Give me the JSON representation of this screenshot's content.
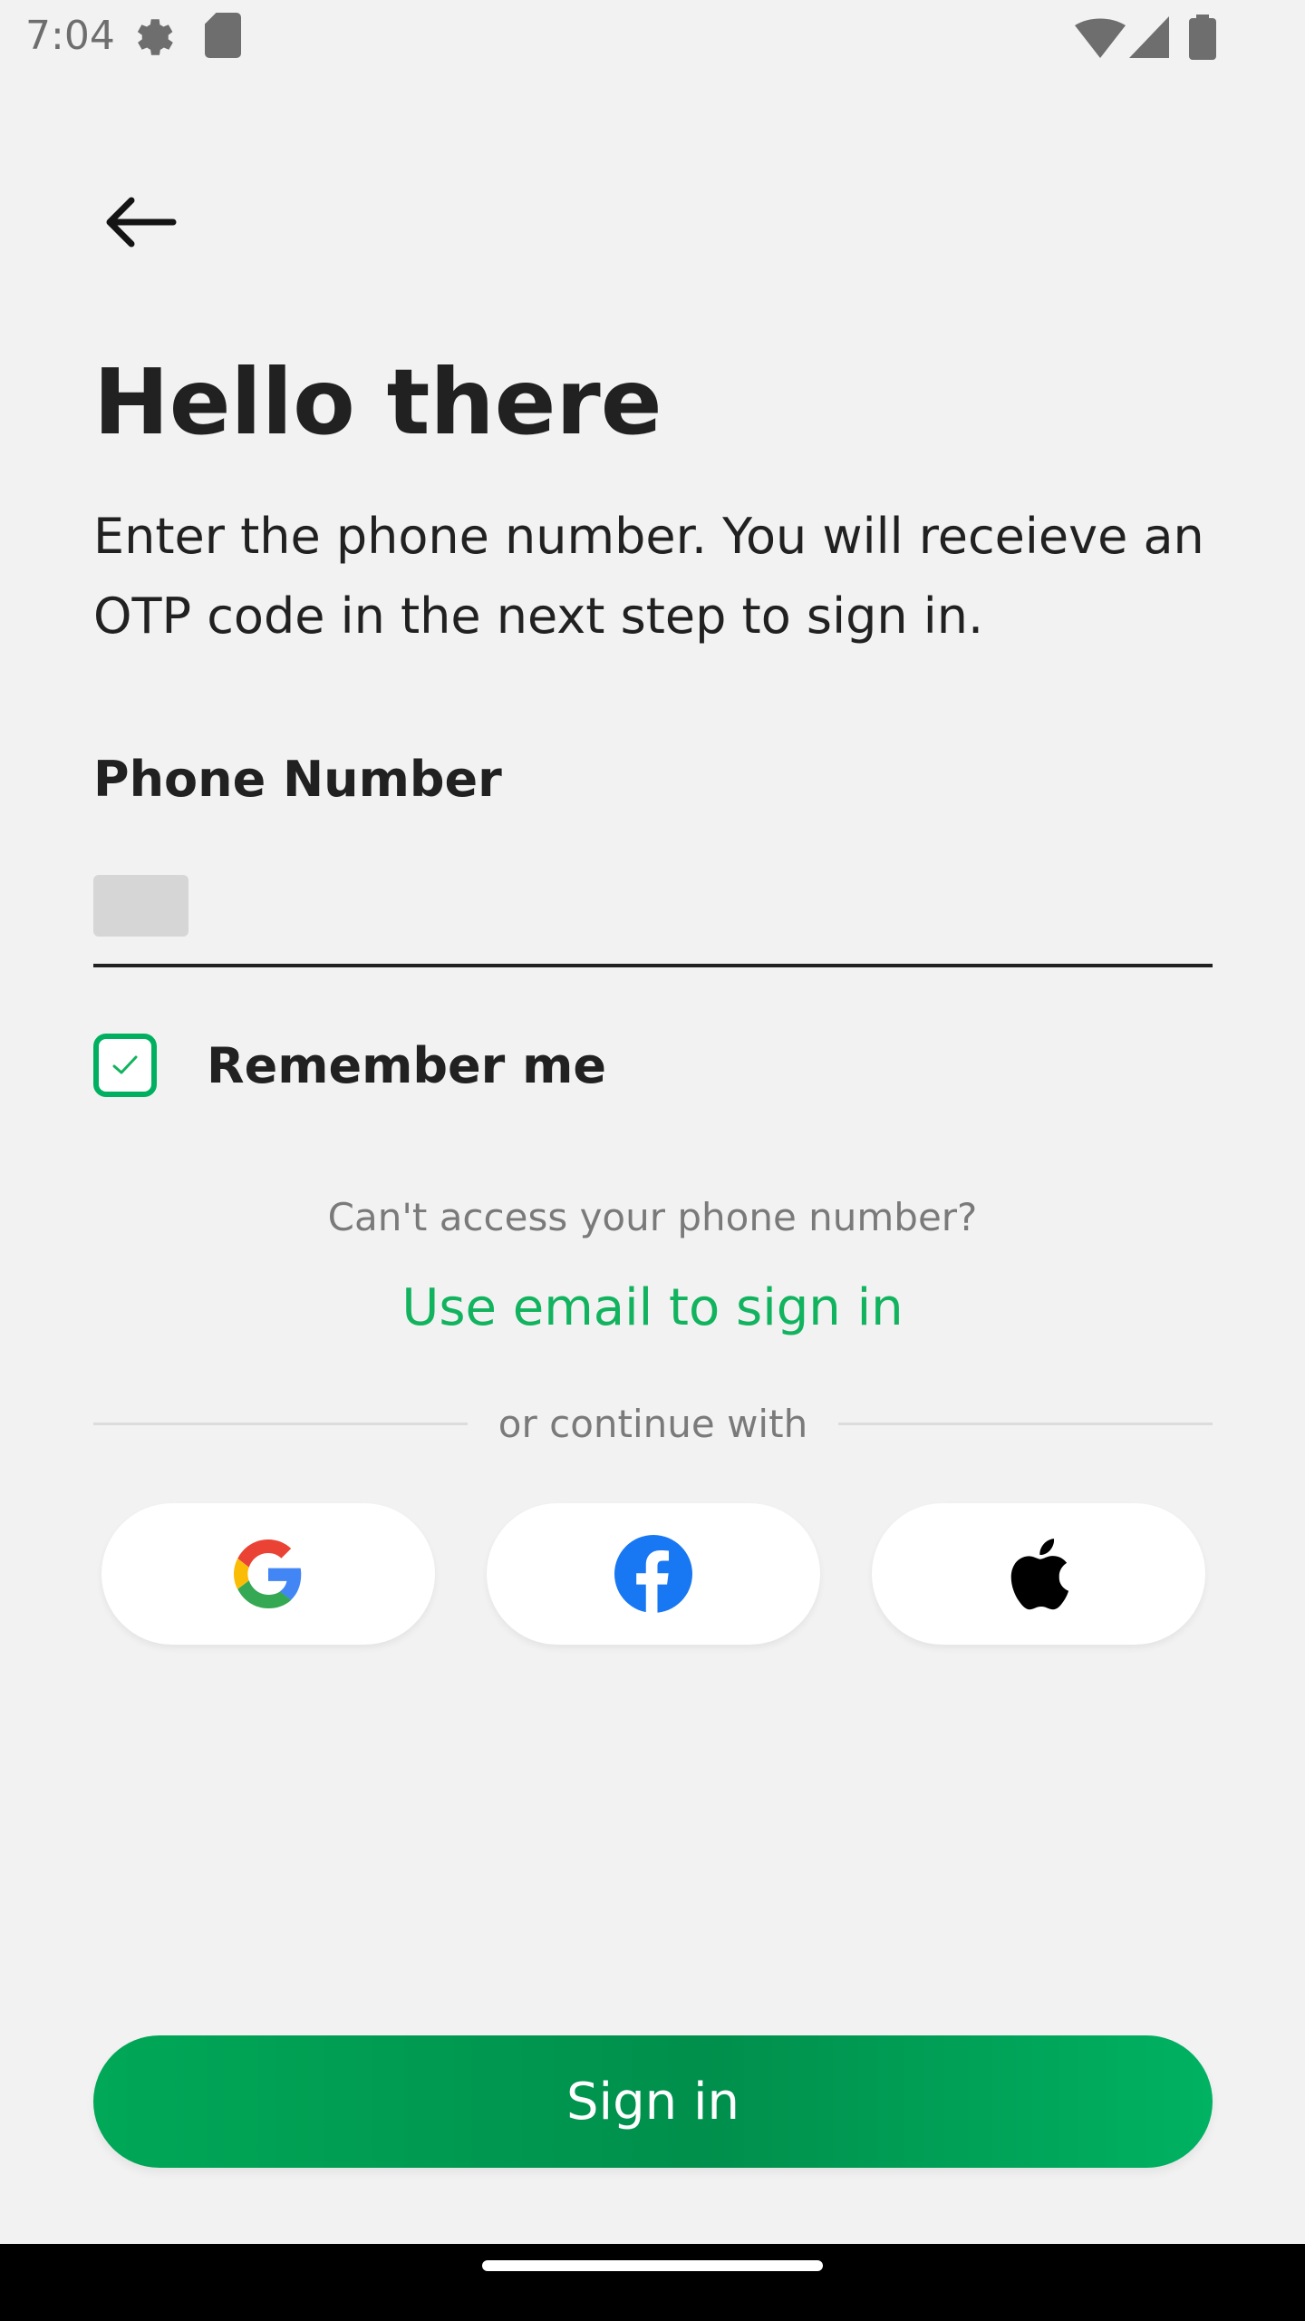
{
  "status_bar": {
    "time": "7:04"
  },
  "header": {
    "title": "Hello there",
    "subtitle": "Enter the phone number. You will receieve an OTP code in the next step to sign in."
  },
  "form": {
    "phone_label": "Phone Number",
    "phone_value": "",
    "remember_label": "Remember me",
    "remember_checked": true
  },
  "alt_signin": {
    "question": "Can't access your phone number?",
    "email_link": "Use email to sign in",
    "divider_text": "or continue with"
  },
  "social": [
    {
      "icon": "google-icon"
    },
    {
      "icon": "facebook-icon"
    },
    {
      "icon": "apple-icon"
    }
  ],
  "actions": {
    "signin_label": "Sign in"
  },
  "colors": {
    "accent": "#12b35e",
    "button": "#00a857",
    "background": "#f2f2f2",
    "facebook": "#1877f2"
  }
}
